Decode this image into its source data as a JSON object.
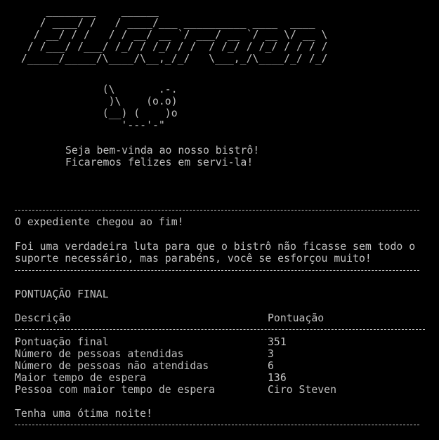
{
  "logo_ascii": "     ________    ______\n    / ____/ /   / ____/___ __________ ____  ____\n   / __/ / /   / / __/ __ `/ ___/ __ `/ __ \\/ __ \\\n  / /___/ /___/ /_/ / /_/ / /  / /_/ / /_/ / / / /\n /_____/_____/\\____/\\__,_/_/   \\___,_/\\____/_/ /_/",
  "logo_text": "El Garçon",
  "chef_ascii": "              (\\       .-.\n               )\\    (o.o)\n              (__) (    )o\n                 '---'-\"",
  "welcome": {
    "line1": "Seja bem-vinda ao nosso bistrô!",
    "line2": "Ficaremos felizes em servi-la!"
  },
  "end_message": "O expediente chegou ao fim!",
  "struggle": {
    "line1": "Foi uma verdadeira luta para que o bistrô não ficasse sem todo o",
    "line2": "suporte necessário, mas parabéns, você se esforçou muito!"
  },
  "score_title": "PONTUAÇÃO FINAL",
  "table": {
    "header_description": "Descrição",
    "header_score": "Pontuação",
    "rows": [
      {
        "label": "Pontuação final",
        "value": "351"
      },
      {
        "label": "Número de pessoas atendidas",
        "value": "3"
      },
      {
        "label": "Número de pessoas não atendidas",
        "value": "6"
      },
      {
        "label": "Maior tempo de espera",
        "value": "136"
      },
      {
        "label": "Pessoa com maior tempo de espera",
        "value": "Ciro Steven"
      }
    ]
  },
  "goodnight": "Tenha uma ótima noite!",
  "colors": {
    "background": "#000000",
    "text": "#c0c0c0"
  }
}
